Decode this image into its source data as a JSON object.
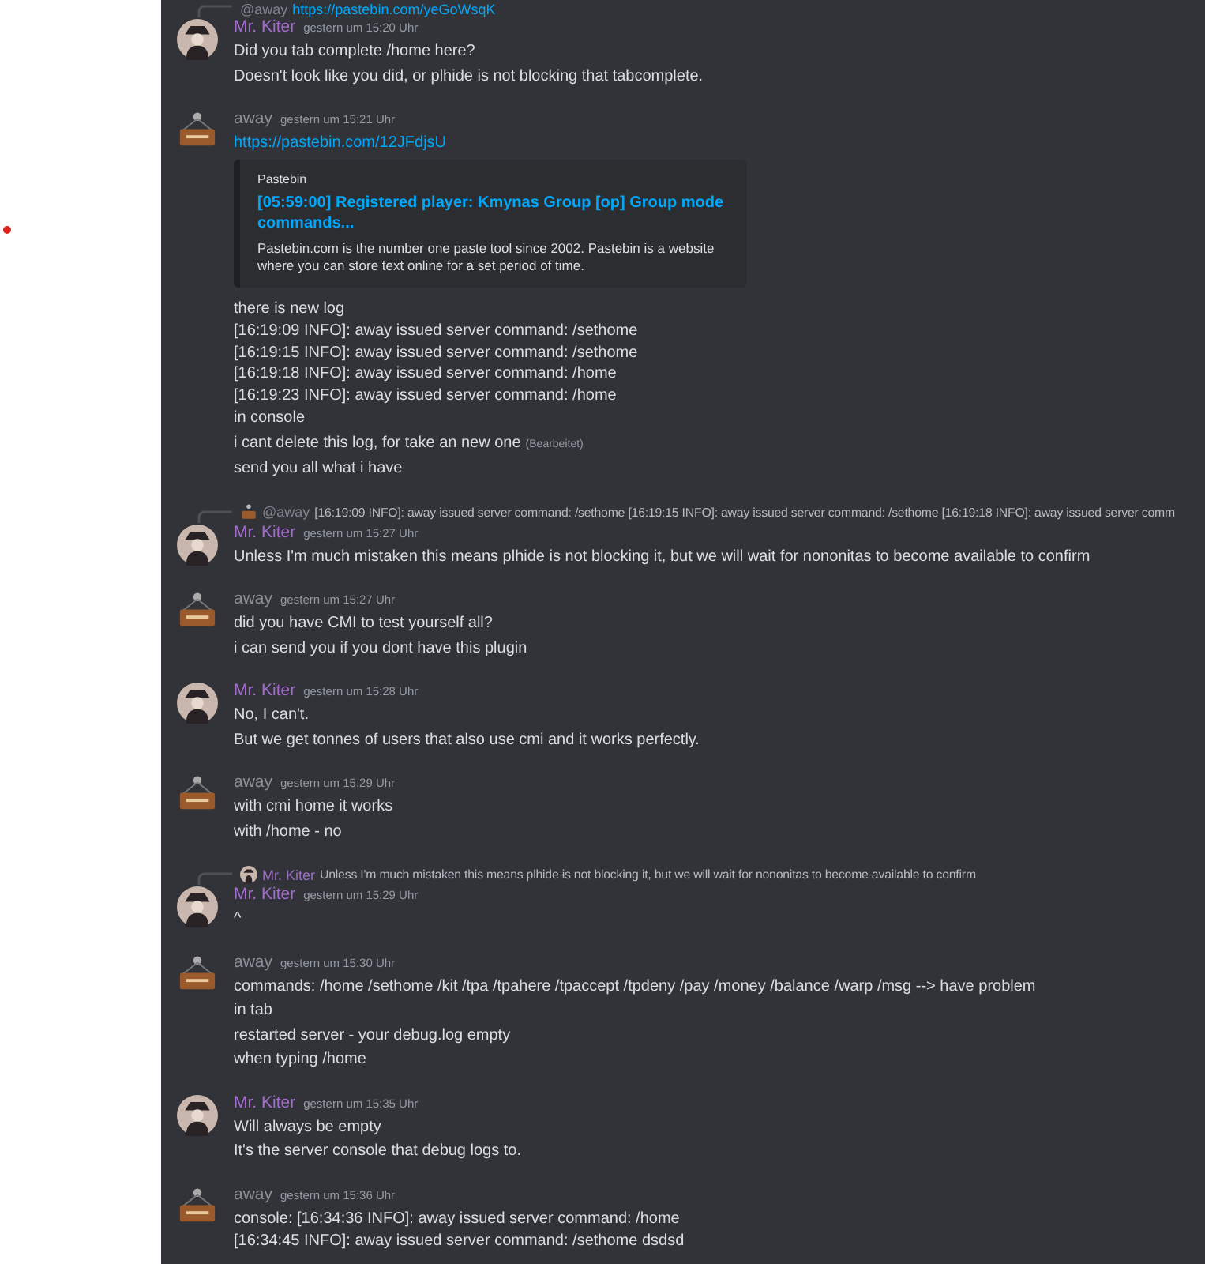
{
  "top_reply": {
    "author": "@away",
    "link": "https://pastebin.com/yeGoWsqK"
  },
  "messages": [
    {
      "kind": "kiter",
      "author": "Mr. Kiter",
      "time": "gestern um 15:20 Uhr",
      "lines": [
        {
          "kind": "text",
          "text": "Did you tab complete /home here?"
        },
        {
          "kind": "text",
          "text": "Doesn't look like you did, or plhide is not blocking that tabcomplete."
        }
      ]
    },
    {
      "kind": "away",
      "author": "away",
      "time": "gestern um 15:21 Uhr",
      "lines": [
        {
          "kind": "link",
          "text": "https://pastebin.com/12JFdjsU"
        },
        {
          "kind": "embed",
          "provider": "Pastebin",
          "title": "[05:59:00] Registered player: Kmynas Group [op] Group mode commands...",
          "description": "Pastebin.com is the number one paste tool since 2002. Pastebin is a website where you can store text online for a set period of time."
        },
        {
          "kind": "text",
          "text": "there is new log"
        },
        {
          "kind": "log",
          "text": "[16:19:09 INFO]: away issued server command: /sethome"
        },
        {
          "kind": "log",
          "text": "[16:19:15 INFO]: away issued server command: /sethome"
        },
        {
          "kind": "log",
          "text": "[16:19:18 INFO]: away issued server command: /home"
        },
        {
          "kind": "log",
          "text": "[16:19:23 INFO]: away issued server command: /home"
        },
        {
          "kind": "text",
          "text": "in console"
        },
        {
          "kind": "text",
          "text": "i cant delete this log, for take an new one",
          "edited": "(Bearbeitet)"
        },
        {
          "kind": "text",
          "text": "send you all what i have"
        }
      ]
    },
    {
      "kind": "kiter",
      "reply": {
        "kind": "away",
        "author": "@away",
        "text": "[16:19:09 INFO]: away issued server command: /sethome [16:19:15 INFO]: away issued server command: /sethome [16:19:18 INFO]: away issued server comm"
      },
      "author": "Mr. Kiter",
      "time": "gestern um 15:27 Uhr",
      "lines": [
        {
          "kind": "text",
          "text": "Unless I'm much mistaken this means plhide is not blocking it, but we will wait for nononitas to become available to confirm"
        }
      ]
    },
    {
      "kind": "away",
      "author": "away",
      "time": "gestern um 15:27 Uhr",
      "lines": [
        {
          "kind": "text",
          "text": "did you have CMI to test yourself all?"
        },
        {
          "kind": "text",
          "text": "i can send you if you dont have this plugin"
        }
      ]
    },
    {
      "kind": "kiter",
      "author": "Mr. Kiter",
      "time": "gestern um 15:28 Uhr",
      "lines": [
        {
          "kind": "text",
          "text": "No, I can't."
        },
        {
          "kind": "text",
          "text": "But we get tonnes of users that also use cmi and it works perfectly."
        }
      ]
    },
    {
      "kind": "away",
      "author": "away",
      "time": "gestern um 15:29 Uhr",
      "lines": [
        {
          "kind": "text",
          "text": "with cmi home it works"
        },
        {
          "kind": "text",
          "text": "with /home - no"
        }
      ]
    },
    {
      "kind": "kiter",
      "reply": {
        "kind": "kiter",
        "author": "Mr. Kiter",
        "text": "Unless I'm much mistaken this means plhide is not blocking it, but we will wait for nononitas to become available to confirm"
      },
      "author": "Mr. Kiter",
      "time": "gestern um 15:29 Uhr",
      "lines": [
        {
          "kind": "text",
          "text": "^"
        }
      ]
    },
    {
      "kind": "away",
      "author": "away",
      "time": "gestern um 15:30 Uhr",
      "lines": [
        {
          "kind": "text",
          "text": "commands: /home /sethome /kit /tpa /tpahere /tpaccept /tpdeny /pay /money /balance /warp /msg --> have problem"
        },
        {
          "kind": "text",
          "text": "in tab"
        },
        {
          "kind": "text",
          "text": "restarted server - your debug.log empty"
        },
        {
          "kind": "text",
          "text": "when typing /home"
        }
      ]
    },
    {
      "kind": "kiter",
      "author": "Mr. Kiter",
      "time": "gestern um 15:35 Uhr",
      "lines": [
        {
          "kind": "text",
          "text": "Will always be empty"
        },
        {
          "kind": "text",
          "text": "It's the server console that debug logs to."
        }
      ]
    },
    {
      "kind": "away",
      "author": "away",
      "time": "gestern um 15:36 Uhr",
      "lines": [
        {
          "kind": "text",
          "text": "console: [16:34:36 INFO]: away issued server command: /home"
        },
        {
          "kind": "log",
          "text": "[16:34:45 INFO]: away issued server command: /sethome dsdsd"
        }
      ]
    }
  ]
}
